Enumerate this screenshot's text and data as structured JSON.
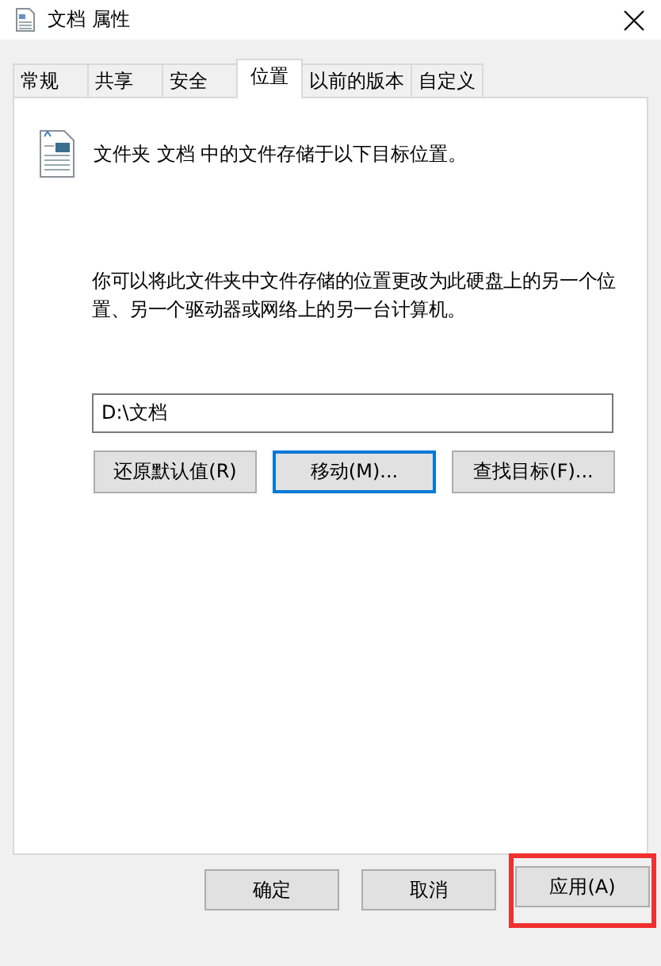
{
  "window": {
    "title": "文档 属性"
  },
  "tabs": [
    {
      "label": "常规",
      "selected": false
    },
    {
      "label": "共享",
      "selected": false
    },
    {
      "label": "安全",
      "selected": false
    },
    {
      "label": "位置",
      "selected": true
    },
    {
      "label": "以前的版本",
      "selected": false
    },
    {
      "label": "自定义",
      "selected": false
    }
  ],
  "header_text": "文件夹 文档 中的文件存储于以下目标位置。",
  "description": "你可以将此文件夹中文件存储的位置更改为此硬盘上的另一个位置、另一个驱动器或网络上的另一台计算机。",
  "path_field": {
    "value": "D:\\文档"
  },
  "location_buttons": [
    {
      "label": "还原默认值(R)",
      "focused": false
    },
    {
      "label": "移动(M)...",
      "focused": true
    },
    {
      "label": "查找目标(F)...",
      "focused": false
    }
  ],
  "dialog_buttons": [
    {
      "label": "确定",
      "highlighted": false
    },
    {
      "label": "取消",
      "highlighted": false
    },
    {
      "label": "应用(A)",
      "highlighted": true
    }
  ]
}
